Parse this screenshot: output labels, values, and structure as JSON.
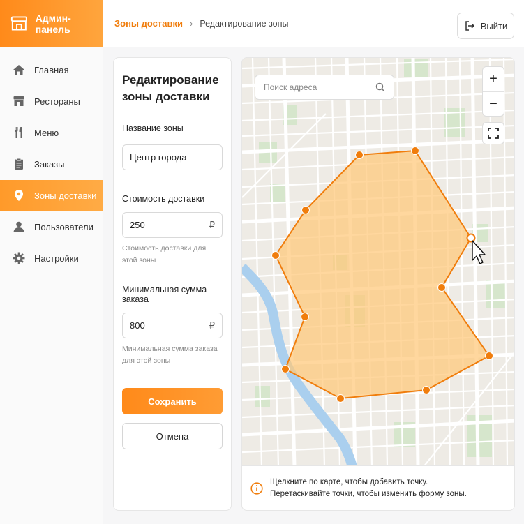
{
  "app": {
    "brand": "Админ-панель"
  },
  "sidebar": {
    "items": [
      {
        "label": "Главная",
        "icon": "home-icon"
      },
      {
        "label": "Рестораны",
        "icon": "store-icon"
      },
      {
        "label": "Меню",
        "icon": "fork-knife-icon"
      },
      {
        "label": "Заказы",
        "icon": "clipboard-icon"
      },
      {
        "label": "Зоны доставки",
        "icon": "map-pin-icon",
        "active": true
      },
      {
        "label": "Пользователи",
        "icon": "user-icon"
      },
      {
        "label": "Настройки",
        "icon": "gear-icon"
      }
    ]
  },
  "breadcrumb": {
    "parent": "Зоны доставки",
    "separator": "›",
    "current": "Редактирование зоны"
  },
  "header": {
    "logout_label": "Выйти"
  },
  "form": {
    "title_line1": "Редактирование",
    "title_line2": "зоны доставки",
    "zone_name_label": "Название зоны",
    "zone_name_value": "Центр города",
    "cost_label": "Стоимость доставки",
    "cost_value": "250",
    "currency": "₽",
    "cost_hint": "Стоимость доставки для этой зоны",
    "min_label": "Минимальная сумма заказа",
    "min_value": "800",
    "min_hint": "Минимальная сумма заказа для этой зоны",
    "save_label": "Сохранить",
    "cancel_label": "Отмена"
  },
  "map": {
    "search_placeholder": "Поиск адреса",
    "zoom_in": "+",
    "zoom_out": "−",
    "info_line1": "Щелкните по карте, чтобы добавить точку.",
    "info_line2": "Перетаскивайте точки, чтобы изменить форму зоны."
  },
  "colors": {
    "accent": "#ff8a1a",
    "zone_fill": "#ffc878",
    "zone_stroke": "#f07d0c",
    "water": "#aacfee"
  }
}
